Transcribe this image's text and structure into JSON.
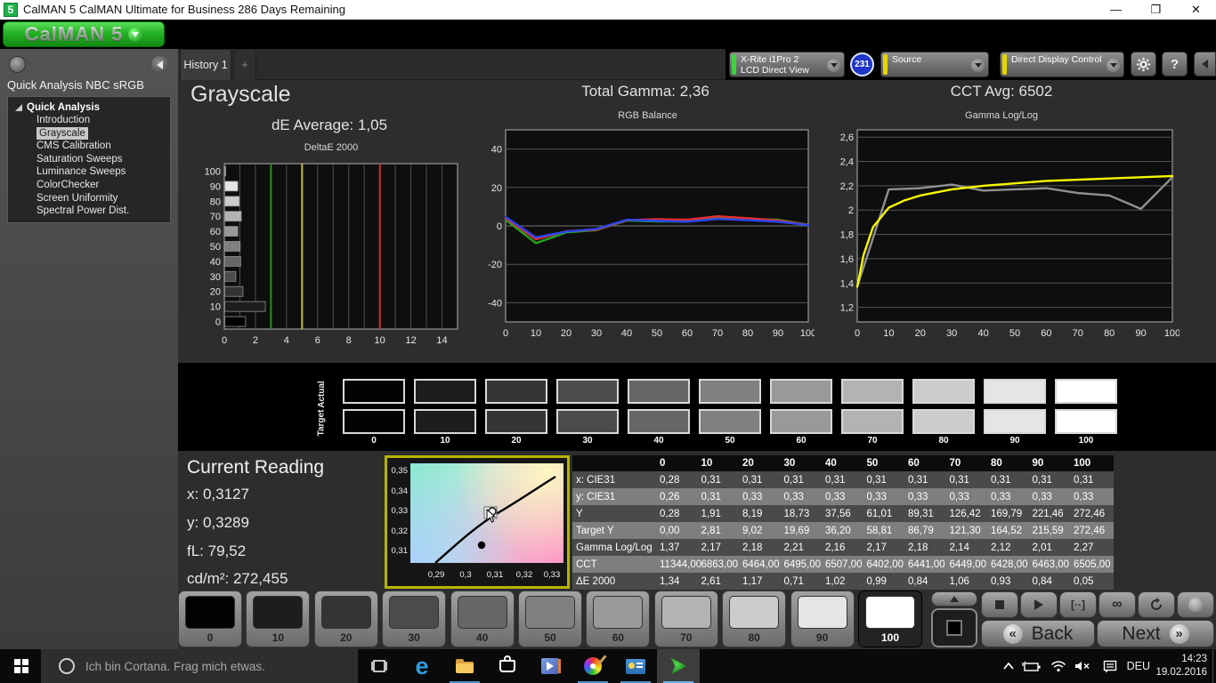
{
  "window": {
    "title": "CalMAN 5 CalMAN Ultimate for Business 286 Days Remaining",
    "title_icon": "5",
    "logo_text": "CalMAN 5"
  },
  "tabs": {
    "history": "History 1",
    "add": "+"
  },
  "toolbar": {
    "meter_line1": "X-Rite i1Pro 2",
    "meter_line2": "LCD Direct View",
    "meter_badge": "231",
    "source_label": "Source",
    "display_control_label": "Direct Display Control",
    "help_label": "?",
    "accent_green": "#3fd43f",
    "accent_yellow": "#e6d800"
  },
  "sidebar": {
    "header": "Quick Analysis NBC sRGB",
    "root": "Quick Analysis",
    "items": [
      "Introduction",
      "Grayscale",
      "CMS Calibration",
      "Saturation Sweeps",
      "Luminance Sweeps",
      "ColorChecker",
      "Screen Uniformity",
      "Spectral Power Dist."
    ],
    "selected": "Grayscale"
  },
  "header": {
    "page_title": "Grayscale",
    "de_average": "dE Average: 1,05",
    "total_gamma": "Total Gamma: 2,36",
    "cct_avg": "CCT Avg: 6502"
  },
  "levels": [
    "0",
    "10",
    "20",
    "30",
    "40",
    "50",
    "60",
    "70",
    "80",
    "90",
    "100"
  ],
  "gray_colors": [
    "#030303",
    "#1d1d1d",
    "#343434",
    "#4b4b4b",
    "#666666",
    "#808080",
    "#999999",
    "#b3b3b3",
    "#cccccc",
    "#e5e5e5",
    "#ffffff"
  ],
  "selected_level": "100",
  "swatch_labels": {
    "actual": "Actual",
    "target": "Target"
  },
  "current_reading": {
    "title": "Current Reading",
    "x": "x: 0,3127",
    "y": "y: 0,3289",
    "fl": "fL: 79,52",
    "cdm2": "cd/m²: 272,455"
  },
  "cie": {
    "x_ticks": [
      "0,29",
      "0,3",
      "0,31",
      "0,32",
      "0,33"
    ],
    "y_ticks": [
      "0,35",
      "0,34",
      "0,33",
      "0,32",
      "0,31"
    ]
  },
  "table": {
    "header": [
      "",
      "0",
      "10",
      "20",
      "30",
      "40",
      "50",
      "60",
      "70",
      "80",
      "90",
      "100"
    ],
    "rows": [
      {
        "label": "x: CIE31",
        "values": [
          "0,28",
          "0,31",
          "0,31",
          "0,31",
          "0,31",
          "0,31",
          "0,31",
          "0,31",
          "0,31",
          "0,31",
          "0,31"
        ]
      },
      {
        "label": "y: CIE31",
        "values": [
          "0,26",
          "0,31",
          "0,33",
          "0,33",
          "0,33",
          "0,33",
          "0,33",
          "0,33",
          "0,33",
          "0,33",
          "0,33"
        ]
      },
      {
        "label": "Y",
        "values": [
          "0,28",
          "1,91",
          "8,19",
          "18,73",
          "37,56",
          "61,01",
          "89,31",
          "126,42",
          "169,79",
          "221,46",
          "272,46"
        ]
      },
      {
        "label": "Target Y",
        "values": [
          "0,00",
          "2,81",
          "9,02",
          "19,69",
          "36,20",
          "58,81",
          "86,79",
          "121,30",
          "164,52",
          "215,59",
          "272,46"
        ]
      },
      {
        "label": "Gamma Log/Log",
        "values": [
          "1,37",
          "2,17",
          "2,18",
          "2,21",
          "2,16",
          "2,17",
          "2,18",
          "2,14",
          "2,12",
          "2,01",
          "2,27"
        ]
      },
      {
        "label": "CCT",
        "values": [
          "11344,00",
          "6863,00",
          "6464,00",
          "6495,00",
          "6507,00",
          "6402,00",
          "6441,00",
          "6449,00",
          "6428,00",
          "6463,00",
          "6505,00"
        ]
      },
      {
        "label": "ΔE 2000",
        "values": [
          "1,34",
          "2,61",
          "1,17",
          "0,71",
          "1,02",
          "0,99",
          "0,84",
          "1,06",
          "0,93",
          "0,84",
          "0,05"
        ]
      }
    ]
  },
  "chart_data": [
    {
      "type": "bar",
      "title": "DeltaE 2000",
      "orientation": "horizontal",
      "categories": [
        "0",
        "10",
        "20",
        "30",
        "40",
        "50",
        "60",
        "70",
        "80",
        "90",
        "100"
      ],
      "values": [
        1.34,
        2.61,
        1.17,
        0.71,
        1.02,
        0.99,
        0.84,
        1.06,
        0.93,
        0.84,
        0.05
      ],
      "xlim": [
        0,
        15
      ],
      "x_ticks": [
        0,
        2,
        4,
        6,
        8,
        10,
        12,
        14
      ],
      "x_tick_labels": [
        "0",
        "2",
        "4",
        "6",
        "8",
        "10",
        "12",
        "14"
      ],
      "grid_step": 1,
      "reference_lines": [
        {
          "value": 3,
          "color": "#2e8c22"
        },
        {
          "value": 5,
          "color": "#c2bb2e"
        },
        {
          "value": 10,
          "color": "#cc2e2e"
        }
      ]
    },
    {
      "type": "line",
      "title": "RGB Balance",
      "x": [
        0,
        10,
        20,
        30,
        40,
        50,
        60,
        70,
        80,
        90,
        100
      ],
      "xlim": [
        0,
        100
      ],
      "ylim": [
        -50,
        50
      ],
      "y_ticks": [
        -40,
        -20,
        0,
        20,
        40
      ],
      "y_tick_labels": [
        "-40",
        "-20",
        "0",
        "20",
        "40"
      ],
      "x_ticks": [
        0,
        10,
        20,
        30,
        40,
        50,
        60,
        70,
        80,
        90,
        100
      ],
      "x_tick_labels": [
        "0",
        "10",
        "20",
        "30",
        "40",
        "50",
        "60",
        "70",
        "80",
        "90",
        "100"
      ],
      "series": [
        {
          "name": "green",
          "color": "#1ea51e",
          "values": [
            3.2,
            -9,
            -3.4,
            -2.2,
            2.8,
            2.3,
            2.2,
            4.2,
            3.6,
            3.2,
            0.6
          ]
        },
        {
          "name": "red",
          "color": "#e82c2c",
          "values": [
            4,
            -7,
            -2.8,
            -2,
            3,
            3.5,
            3.2,
            5,
            4,
            2.8,
            0.5
          ]
        },
        {
          "name": "blue",
          "color": "#2b46f0",
          "values": [
            4.6,
            -6,
            -3,
            -1.6,
            3.2,
            2.6,
            2.2,
            3.6,
            3,
            2.2,
            0.4
          ]
        }
      ]
    },
    {
      "type": "line",
      "title": "Gamma Log/Log",
      "x": [
        0,
        10,
        20,
        30,
        40,
        50,
        60,
        70,
        80,
        90,
        100
      ],
      "xlim": [
        0,
        100
      ],
      "ylim": [
        1.08,
        2.66
      ],
      "y_ticks": [
        1.2,
        1.4,
        1.6,
        1.8,
        2,
        2.2,
        2.4,
        2.6
      ],
      "y_tick_labels": [
        "1,2",
        "1,4",
        "1,6",
        "1,8",
        "2",
        "2,2",
        "2,4",
        "2,6"
      ],
      "x_ticks": [
        0,
        10,
        20,
        30,
        40,
        50,
        60,
        70,
        80,
        90,
        100
      ],
      "x_tick_labels": [
        "0",
        "10",
        "20",
        "30",
        "40",
        "50",
        "60",
        "70",
        "80",
        "90",
        "100"
      ],
      "series": [
        {
          "name": "measured",
          "color": "#909090",
          "values": [
            1.37,
            2.17,
            2.18,
            2.21,
            2.16,
            2.17,
            2.18,
            2.14,
            2.12,
            2.01,
            2.27
          ]
        },
        {
          "name": "target",
          "color": "#f8f800",
          "x": [
            0,
            2,
            5,
            10,
            15,
            20,
            30,
            40,
            50,
            60,
            70,
            80,
            90,
            100
          ],
          "values": [
            1.37,
            1.63,
            1.86,
            2.02,
            2.08,
            2.12,
            2.17,
            2.2,
            2.22,
            2.24,
            2.25,
            2.26,
            2.27,
            2.28
          ]
        }
      ]
    }
  ],
  "transport": {
    "back": "Back",
    "next": "Next",
    "back_chev": "«",
    "next_chev": "»"
  },
  "taskbar": {
    "cortana_text": "Ich bin Cortana. Frag mich etwas.",
    "lang": "DEU",
    "time": "14:23",
    "date": "19.02.2016"
  }
}
